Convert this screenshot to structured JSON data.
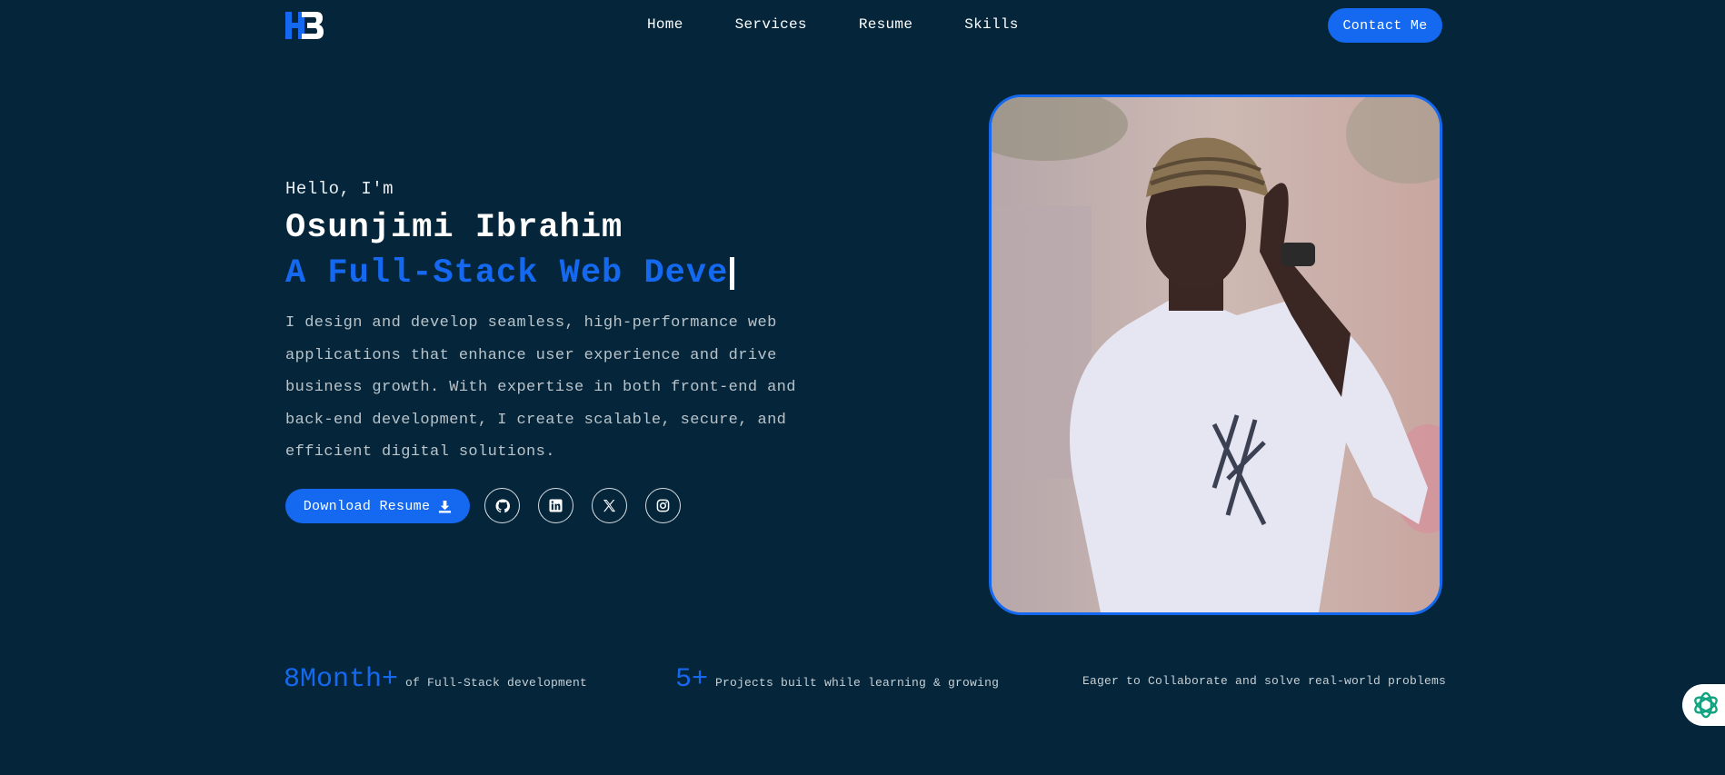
{
  "nav": {
    "logo_alt": "HB",
    "links": [
      "Home",
      "Services",
      "Resume",
      "Skills"
    ],
    "contact_label": "Contact Me"
  },
  "hero": {
    "greeting": "Hello, I'm",
    "name": "Osunjimi Ibrahim",
    "role_typed": "A Full-Stack Web Deve",
    "bio": "I design and develop seamless, high-performance web applications that enhance user experience and drive business growth. With expertise in both front-end and back-end development, I create scalable, secure, and efficient digital solutions.",
    "download_label": "Download Resume",
    "socials": [
      "github-icon",
      "linkedin-icon",
      "x-icon",
      "instagram-icon"
    ]
  },
  "stats": [
    {
      "number": "8Month+",
      "text": "of Full-Stack development"
    },
    {
      "number": "5+",
      "text": "Projects built while learning & growing"
    },
    {
      "number": "",
      "text": "Eager to Collaborate and solve real-world problems"
    }
  ],
  "colors": {
    "background": "#05263a",
    "accent": "#1469f0",
    "text": "#ffffff",
    "muted": "#b9c3ca"
  }
}
